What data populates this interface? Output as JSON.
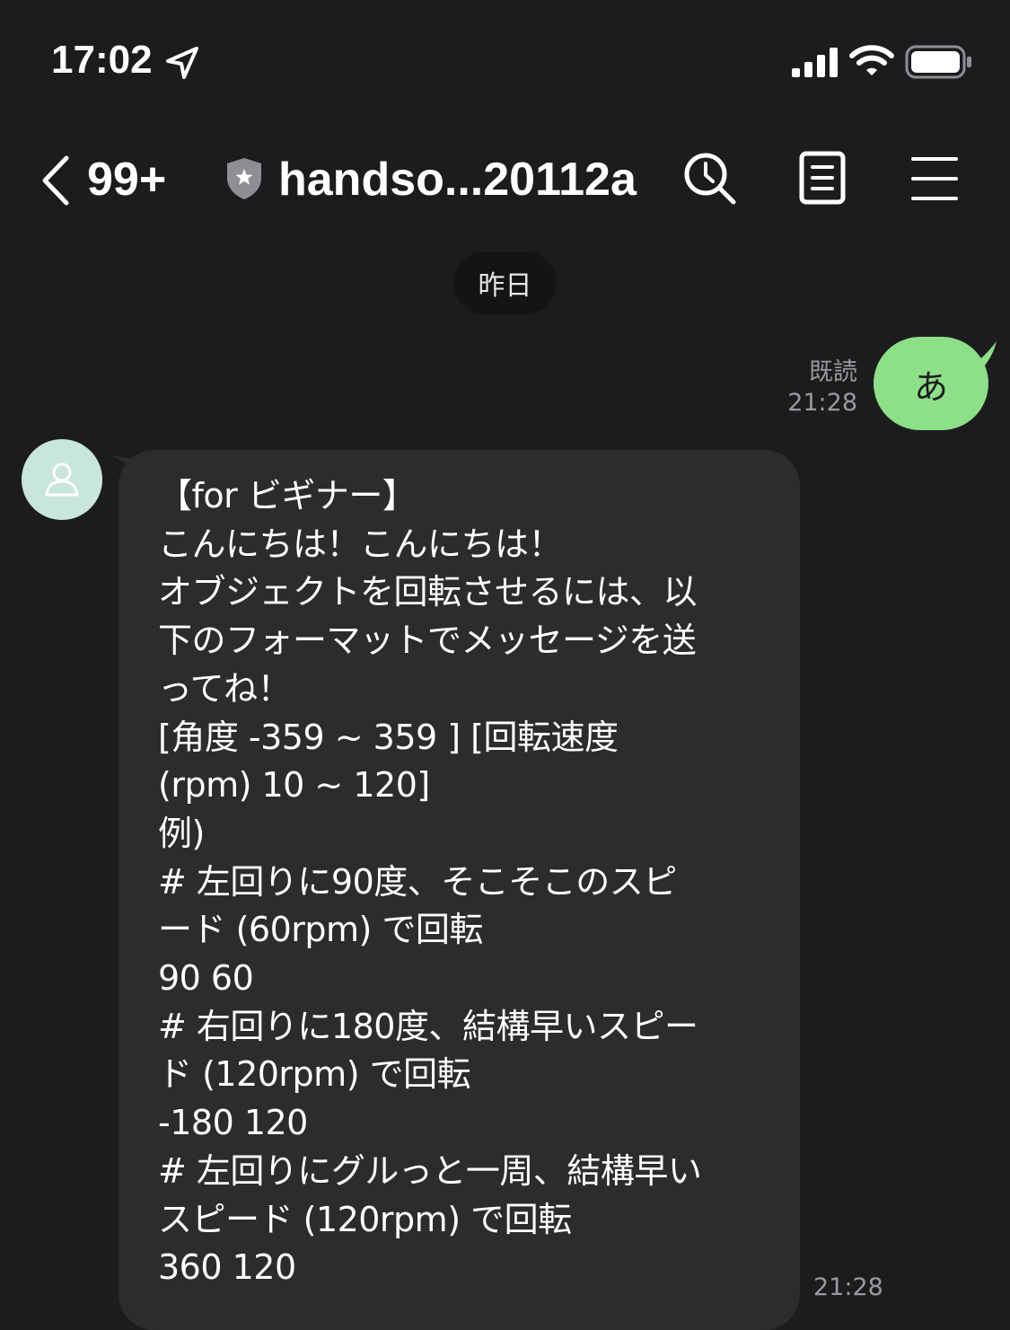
{
  "status_bar": {
    "time": "17:02",
    "icons": [
      "location-arrow-icon",
      "signal-icon",
      "wifi-icon",
      "battery-icon"
    ]
  },
  "header": {
    "unread_count": "99+",
    "title": "handso...20112a",
    "icons": [
      "back-chevron-icon",
      "shield-icon",
      "search-icon",
      "note-icon",
      "menu-icon"
    ]
  },
  "date_divider": "昨日",
  "messages": {
    "outgoing": {
      "text": "あ",
      "read_label": "既読",
      "time": "21:28",
      "bubble_color": "#8de088"
    },
    "incoming": {
      "time": "21:28",
      "bubble_color": "#2c2c2e",
      "lines": [
        "【for ビギナー】",
        "こんにちは！こんにちは！",
        "オブジェクトを回転させるには、以",
        "下のフォーマットでメッセージを送",
        "ってね！",
        "[角度 -359 ~ 359 ] [回転速度",
        "(rpm) 10 ~ 120]",
        "例)",
        "# 左回りに90度、そこそこのスピ",
        "ード (60rpm) で回転",
        "90 60",
        "# 右回りに180度、結構早いスピー",
        "ド (120rpm) で回転",
        "-180 120",
        "# 左回りにグルっと一周、結構早い",
        "スピード (120rpm) で回転",
        "360 120"
      ]
    }
  },
  "colors": {
    "background": "#1c1c1e",
    "avatar_bg": "#c9e6dd",
    "meta_text": "#9a9a9e"
  }
}
